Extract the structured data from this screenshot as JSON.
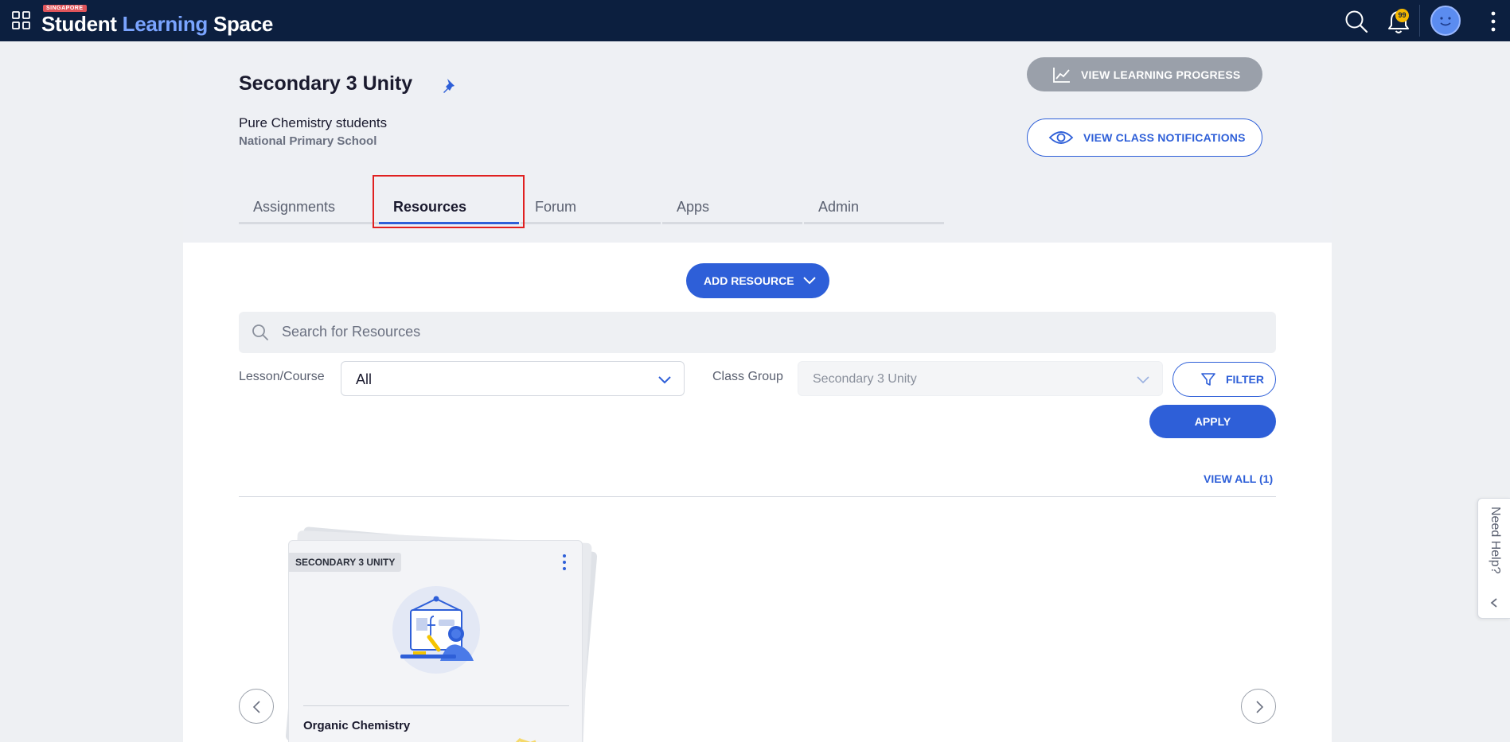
{
  "header": {
    "logo_tag": "SINGAPORE",
    "logo_part1": "Student",
    "logo_part2": "Learning",
    "logo_part3": "Space",
    "notification_count": "99"
  },
  "class_info": {
    "title": "Secondary 3 Unity",
    "subtitle": "Pure Chemistry students",
    "school": "National Primary School"
  },
  "actions": {
    "view_progress": "VIEW LEARNING PROGRESS",
    "view_notifications": "VIEW CLASS NOTIFICATIONS"
  },
  "tabs": [
    {
      "label": "Assignments",
      "active": false
    },
    {
      "label": "Resources",
      "active": true
    },
    {
      "label": "Forum",
      "active": false
    },
    {
      "label": "Apps",
      "active": false
    },
    {
      "label": "Admin",
      "active": false
    }
  ],
  "toolbar": {
    "add_resource": "ADD RESOURCE",
    "search_placeholder": "Search for Resources",
    "lesson_label": "Lesson/Course",
    "lesson_value": "All",
    "class_group_label": "Class Group",
    "class_group_value": "Secondary 3 Unity",
    "filter": "FILTER",
    "apply": "APPLY",
    "view_all": "VIEW ALL (1)"
  },
  "cards": [
    {
      "badge": "SECONDARY 3 UNITY",
      "title": "Organic Chemistry"
    }
  ],
  "help": {
    "label": "Need Help?"
  },
  "colors": {
    "topbar": "#0c1f3f",
    "accent": "#2e5fd8",
    "badge": "#f5b800",
    "highlight": "#e02020"
  },
  "icons": [
    "apps-grid-icon",
    "search-icon",
    "bell-icon",
    "avatar",
    "more-vertical-icon",
    "pin-icon",
    "chart-line-icon",
    "eye-icon",
    "chevron-down-icon",
    "filter-icon",
    "chevron-left-icon",
    "chevron-right-icon"
  ]
}
